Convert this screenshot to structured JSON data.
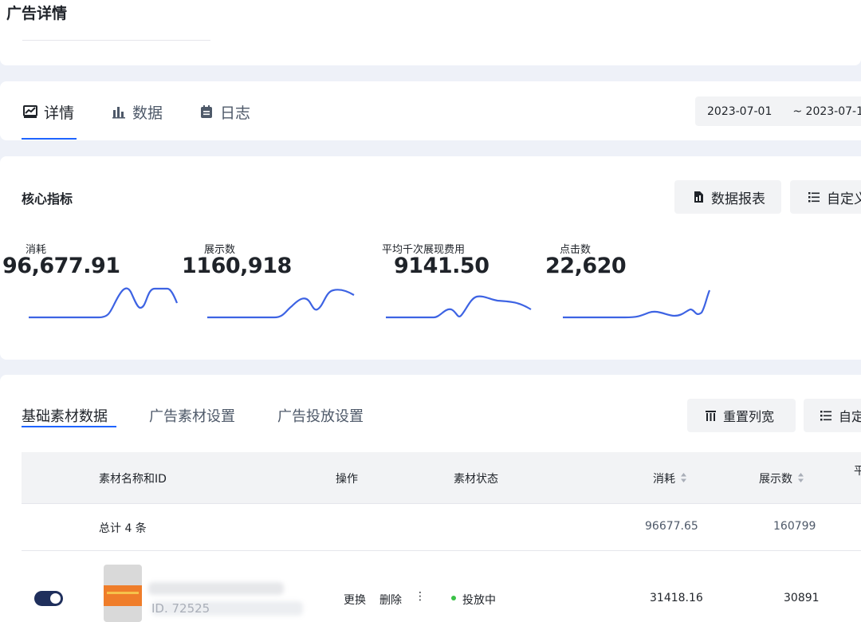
{
  "page_title": "广告详情",
  "tabs": [
    {
      "label": "详情",
      "icon": "chart-area-icon"
    },
    {
      "label": "数据",
      "icon": "bar-chart-icon"
    },
    {
      "label": "日志",
      "icon": "calendar-note-icon"
    }
  ],
  "date_range": {
    "start": "2023-07-01",
    "sep_end": "~ 2023-07-1"
  },
  "core": {
    "title": "核心指标",
    "report_button": "数据报表",
    "custom_button": "自定义"
  },
  "metrics": [
    {
      "label": "消耗",
      "value": "96,677.91"
    },
    {
      "label": "展示数",
      "value": "1160,918"
    },
    {
      "label": "平均千次展现费用",
      "value": "9141.50"
    },
    {
      "label": "点击数",
      "value": "22,620"
    }
  ],
  "sub_tabs": [
    "基础素材数据",
    "广告素材设置",
    "广告投放设置"
  ],
  "table_buttons": {
    "reset": "重置列宽",
    "custom": "自定"
  },
  "columns": {
    "name": "素材名称和ID",
    "ops": "操作",
    "status": "素材状态",
    "spend": "消耗",
    "impressions": "展示数",
    "extra": "平"
  },
  "total_row": {
    "label": "总计 4 条",
    "spend": "96677.65",
    "impressions": "160799"
  },
  "rows": [
    {
      "id_prefix": "ID. 72525",
      "ops": {
        "replace": "更换",
        "delete": "删除",
        "more": "⋮"
      },
      "status": "投放中",
      "spend": "31418.16",
      "impressions": "30891"
    }
  ],
  "colors": {
    "accent": "#1e64ff",
    "spark": "#3d63e3",
    "status_green": "#39c146"
  }
}
